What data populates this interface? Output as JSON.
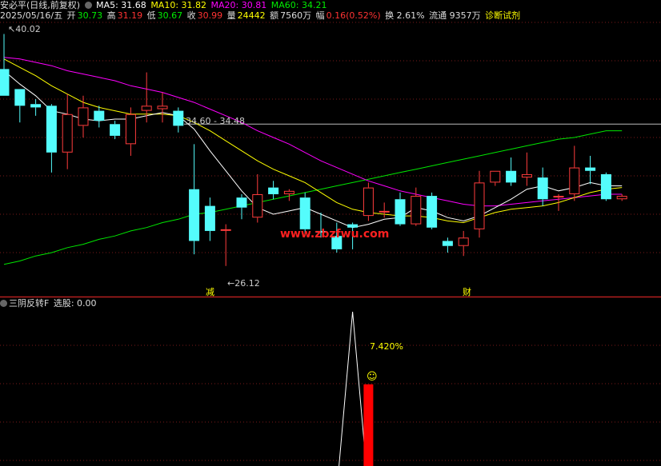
{
  "colors": {
    "up": "#ff3c3c",
    "down": "#54fcfc",
    "ma5": "#ffffff",
    "ma10": "#ffff00",
    "ma20": "#ff00ff",
    "ma60": "#00e600",
    "grid": "#7a1a1a",
    "divider": "#b41e1e",
    "label": "#cccccc",
    "watermark": "#ff2020"
  },
  "header": {
    "title": "安必平(日线,前复权)",
    "ma5": "MA5: 31.68",
    "ma10": "MA10: 31.82",
    "ma20": "MA20: 30.81",
    "ma60": "MA60: 34.21"
  },
  "info": {
    "date": "2025/05/16/五",
    "open_label": "开",
    "open": "30.73",
    "high_label": "高",
    "high": "31.19",
    "low_label": "低",
    "low": "30.67",
    "close_label": "收",
    "close": "30.99",
    "vol_label": "量",
    "vol": "24442",
    "amt_label": "额",
    "amt": "7560万",
    "chg_label": "幅",
    "chg": "0.16(0.52%)",
    "turnover": "换 2.61%",
    "float": "流通 9357万",
    "diag": "诊断试剂"
  },
  "annotations": {
    "high_mark": "40.02",
    "range": "34.60 - 34.48",
    "low_mark": "26.12",
    "jian": "减",
    "cai": "财",
    "watermark": "www.zbzfwu.com"
  },
  "indicator": {
    "title": "三阴反转F",
    "value": "选股: 0.00",
    "pct": "7.420%"
  },
  "chart_data": {
    "type": "candlestick",
    "price_range": [
      24.7,
      40.6
    ],
    "candles": [
      {
        "o": 37.9,
        "h": 40.0,
        "c": 36.3,
        "l": 36.3
      },
      {
        "o": 36.7,
        "h": 36.7,
        "c": 35.7,
        "l": 34.7
      },
      {
        "o": 35.8,
        "h": 36.1,
        "c": 35.6,
        "l": 35.1
      },
      {
        "o": 35.7,
        "h": 35.8,
        "c": 32.9,
        "l": 31.7
      },
      {
        "o": 32.9,
        "h": 36.4,
        "c": 35.2,
        "l": 31.9
      },
      {
        "o": 34.5,
        "h": 36.3,
        "c": 35.6,
        "l": 33.8
      },
      {
        "o": 35.4,
        "h": 35.7,
        "c": 34.8,
        "l": 34.4
      },
      {
        "o": 34.6,
        "h": 34.8,
        "c": 33.9,
        "l": 33.7
      },
      {
        "o": 33.4,
        "h": 35.6,
        "c": 35.2,
        "l": 32.7
      },
      {
        "o": 35.4,
        "h": 37.7,
        "c": 35.7,
        "l": 34.7
      },
      {
        "o": 35.5,
        "h": 36.5,
        "c": 35.7,
        "l": 34.7
      },
      {
        "o": 35.4,
        "h": 35.6,
        "c": 34.5,
        "l": 34.1
      },
      {
        "o": 30.7,
        "h": 33.4,
        "c": 27.6,
        "l": 26.8
      },
      {
        "o": 29.7,
        "h": 30.2,
        "c": 28.2,
        "l": 27.6
      },
      {
        "o": 28.3,
        "h": 28.6,
        "c": 28.3,
        "l": 26.1
      },
      {
        "o": 30.2,
        "h": 30.4,
        "c": 29.6,
        "l": 28.9
      },
      {
        "o": 29.0,
        "h": 31.6,
        "c": 30.4,
        "l": 28.7
      },
      {
        "o": 30.8,
        "h": 31.2,
        "c": 30.4,
        "l": 30.1
      },
      {
        "o": 30.4,
        "h": 30.7,
        "c": 30.6,
        "l": 30.0
      },
      {
        "o": 30.2,
        "h": 30.5,
        "c": 28.3,
        "l": 27.9
      },
      {
        "o": 28.2,
        "h": 29.3,
        "c": 28.1,
        "l": 27.8
      },
      {
        "o": 27.9,
        "h": 28.7,
        "c": 27.1,
        "l": 26.9
      },
      {
        "o": 28.6,
        "h": 28.7,
        "c": 28.4,
        "l": 27.1
      },
      {
        "o": 29.1,
        "h": 31.1,
        "c": 30.8,
        "l": 28.8
      },
      {
        "o": 29.4,
        "h": 29.9,
        "c": 29.4,
        "l": 29.0
      },
      {
        "o": 30.1,
        "h": 30.5,
        "c": 28.6,
        "l": 28.5
      },
      {
        "o": 28.6,
        "h": 30.8,
        "c": 30.3,
        "l": 28.5
      },
      {
        "o": 30.3,
        "h": 30.5,
        "c": 28.4,
        "l": 28.3
      },
      {
        "o": 27.6,
        "h": 27.8,
        "c": 27.3,
        "l": 26.9
      },
      {
        "o": 27.3,
        "h": 28.2,
        "c": 27.8,
        "l": 26.7
      },
      {
        "o": 28.3,
        "h": 31.8,
        "c": 31.1,
        "l": 27.8
      },
      {
        "o": 31.1,
        "h": 31.8,
        "c": 31.8,
        "l": 30.9
      },
      {
        "o": 31.8,
        "h": 32.6,
        "c": 31.1,
        "l": 30.9
      },
      {
        "o": 31.4,
        "h": 32.9,
        "c": 31.6,
        "l": 30.9
      },
      {
        "o": 31.4,
        "h": 32.0,
        "c": 30.1,
        "l": 29.7
      },
      {
        "o": 30.3,
        "h": 30.4,
        "c": 30.3,
        "l": 29.4
      },
      {
        "o": 30.4,
        "h": 33.3,
        "c": 32.0,
        "l": 30.0
      },
      {
        "o": 32.0,
        "h": 32.7,
        "c": 31.8,
        "l": 31.0
      },
      {
        "o": 31.6,
        "h": 31.7,
        "c": 30.1,
        "l": 30.0
      },
      {
        "o": 30.1,
        "h": 30.4,
        "c": 30.3,
        "l": 30.0
      }
    ],
    "ma5": [
      37.8,
      37.0,
      36.3,
      35.4,
      35.2,
      34.9,
      34.8,
      34.9,
      34.9,
      35.1,
      35.3,
      35.1,
      34.3,
      33.0,
      31.8,
      30.6,
      29.6,
      29.2,
      29.4,
      29.6,
      29.2,
      28.8,
      28.4,
      28.6,
      28.9,
      29.0,
      29.6,
      29.4,
      29.0,
      28.8,
      29.1,
      29.6,
      30.1,
      30.7,
      30.9,
      30.6,
      30.8,
      31.1,
      30.9,
      30.9
    ],
    "ma10": [
      38.5,
      38.0,
      37.5,
      36.9,
      36.4,
      35.9,
      35.6,
      35.4,
      35.2,
      35.2,
      35.2,
      35.1,
      34.7,
      34.2,
      33.6,
      33.0,
      32.4,
      31.9,
      31.5,
      31.1,
      30.5,
      29.9,
      29.5,
      29.3,
      29.2,
      29.1,
      29.1,
      29.0,
      28.8,
      28.7,
      29.0,
      29.3,
      29.5,
      29.6,
      29.7,
      29.9,
      30.2,
      30.5,
      30.7,
      30.8
    ],
    "ma20": [
      38.6,
      38.5,
      38.3,
      38.1,
      37.8,
      37.6,
      37.4,
      37.2,
      36.9,
      36.7,
      36.5,
      36.2,
      35.9,
      35.5,
      35.1,
      34.7,
      34.2,
      33.8,
      33.4,
      32.9,
      32.4,
      32.0,
      31.6,
      31.2,
      30.9,
      30.6,
      30.4,
      30.2,
      30.0,
      29.8,
      29.7,
      29.7,
      29.8,
      29.9,
      30.0,
      30.1,
      30.2,
      30.3,
      30.4,
      30.4
    ],
    "ma60": [
      26.2,
      26.4,
      26.7,
      26.9,
      27.2,
      27.4,
      27.7,
      27.9,
      28.2,
      28.4,
      28.7,
      28.9,
      29.2,
      29.3,
      29.5,
      29.7,
      29.9,
      30.1,
      30.3,
      30.5,
      30.7,
      30.9,
      31.1,
      31.3,
      31.5,
      31.7,
      31.9,
      32.1,
      32.3,
      32.5,
      32.7,
      32.9,
      33.1,
      33.3,
      33.5,
      33.7,
      33.8,
      34.0,
      34.2,
      34.2
    ],
    "indicator": {
      "x_index": 22,
      "peak": 100,
      "bar_index": 23,
      "bar_value": 40
    }
  }
}
